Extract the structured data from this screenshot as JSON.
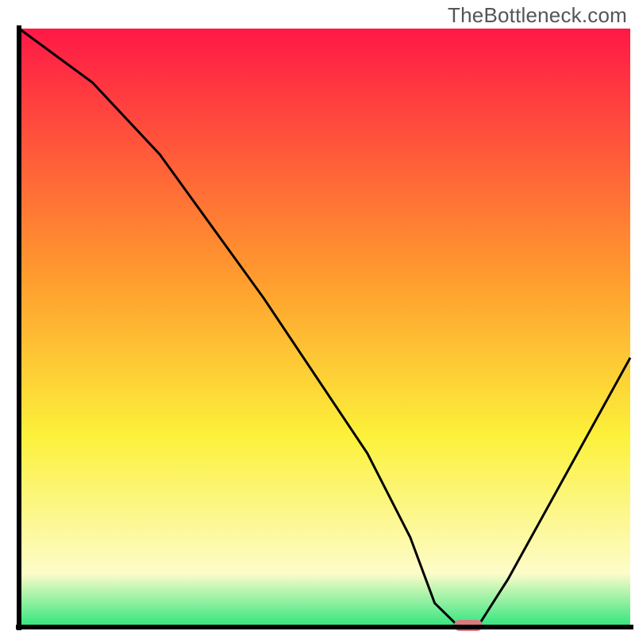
{
  "watermark": {
    "text": "TheBottleneck.com"
  },
  "chart_data": {
    "type": "line",
    "title": "",
    "xlabel": "",
    "ylabel": "",
    "xlim": [
      0,
      100
    ],
    "ylim": [
      0,
      100
    ],
    "grid": false,
    "legend": false,
    "gradient_background": {
      "top": "#ff1846",
      "mid_upper": "#ff9a2e",
      "mid": "#fcf13a",
      "lower": "#fdfcc9",
      "bottom": "#2fe57d"
    },
    "series": [
      {
        "name": "bottleneck-curve",
        "x": [
          0,
          12,
          23,
          40,
          57,
          64,
          68,
          72,
          75,
          80,
          100
        ],
        "values": [
          100,
          91,
          79,
          55,
          29,
          15,
          4,
          0,
          0,
          8,
          45
        ]
      }
    ],
    "marker": {
      "name": "optimal-point",
      "x": 73.5,
      "y": 0,
      "color": "#d87a7e"
    }
  }
}
